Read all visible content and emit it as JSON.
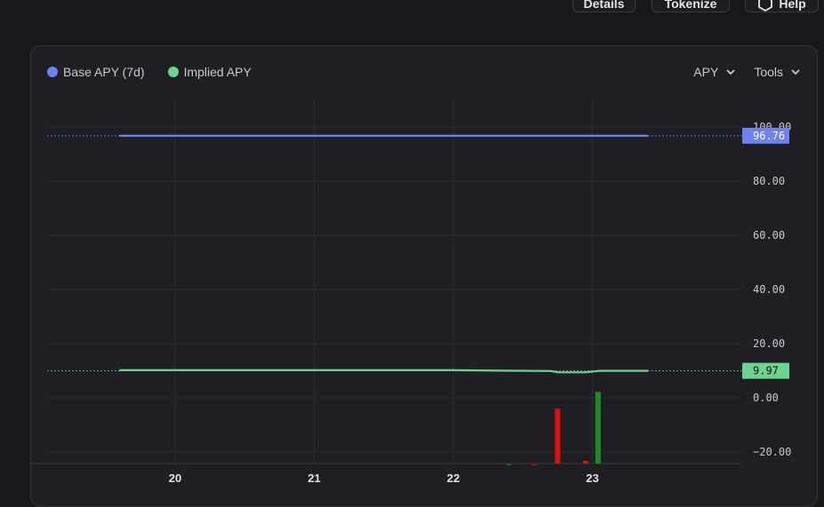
{
  "top_buttons": [
    {
      "label": "Details"
    },
    {
      "label": "Tokenize"
    },
    {
      "label": "Help",
      "icon": "hexagon-icon"
    }
  ],
  "legend": [
    {
      "label": "Base APY (7d)",
      "color": "#6b82f0"
    },
    {
      "label": "Implied APY",
      "color": "#6ad58f"
    }
  ],
  "controls": {
    "apy_label": "APY",
    "tools_label": "Tools"
  },
  "chart_data": {
    "type": "line",
    "x_ticks": [
      "20",
      "21",
      "22",
      "23"
    ],
    "y_ticks": [
      "100.00",
      "80.00",
      "60.00",
      "40.00",
      "20.00",
      "0.00",
      "−20.00"
    ],
    "ylim": [
      -25,
      104
    ],
    "grid": true,
    "series": [
      {
        "name": "Base APY (7d)",
        "color": "#6b82f0",
        "last_value_label": "96.76",
        "x": [
          19.6,
          20.0,
          21.0,
          22.0,
          23.0,
          23.4
        ],
        "y": [
          96.76,
          96.76,
          96.76,
          96.76,
          96.76,
          96.76
        ]
      },
      {
        "name": "Implied APY",
        "color": "#6ad58f",
        "last_value_label": "9.97",
        "x": [
          19.6,
          20.0,
          21.0,
          22.0,
          22.4,
          22.7,
          22.75,
          22.95,
          23.05,
          23.4
        ],
        "y": [
          10.2,
          10.2,
          10.2,
          10.2,
          10.0,
          9.9,
          9.4,
          9.4,
          9.97,
          9.97
        ]
      }
    ],
    "volume_bars": [
      {
        "x": 22.4,
        "value": -24.5,
        "color": "#1f8a2a"
      },
      {
        "x": 22.58,
        "value": -24.6,
        "color": "#e01010"
      },
      {
        "x": 22.75,
        "value": -4,
        "color": "#e01010"
      },
      {
        "x": 22.95,
        "value": -23.3,
        "color": "#e01010"
      },
      {
        "x": 23.04,
        "value": 2.2,
        "color": "#1f8a2a"
      }
    ]
  }
}
